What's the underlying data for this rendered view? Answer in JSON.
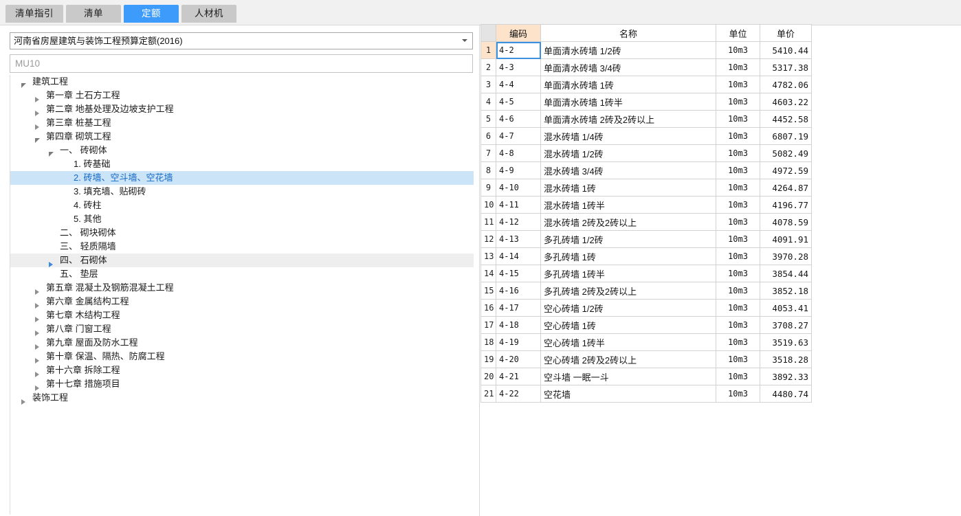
{
  "tabs": [
    {
      "label": "清单指引",
      "active": false
    },
    {
      "label": "清单",
      "active": false
    },
    {
      "label": "定额",
      "active": true
    },
    {
      "label": "人材机",
      "active": false
    }
  ],
  "combo": {
    "value": "河南省房屋建筑与装饰工程预算定额(2016)",
    "arrow_icon": "chevron-down-icon"
  },
  "search": {
    "value": "",
    "placeholder": "MU10"
  },
  "colors": {
    "accent_blue": "#3d9bfb",
    "tab_inactive": "#c9c9c9",
    "selected_row": "#cce4f7",
    "selected_text": "#1569c7",
    "hover_row": "#eeeeee",
    "header_highlight": "#fce3ca",
    "header_index": "#e4e4e4",
    "focus_border": "#3d8fe0",
    "topbar_bg": "#f1f1f1"
  },
  "tree": {
    "nodes": [
      {
        "label": "建筑工程",
        "indent": 0,
        "state": "expanded",
        "selected": false,
        "hovered": false
      },
      {
        "label": "第一章 土石方工程",
        "indent": 1,
        "state": "collapsed",
        "selected": false,
        "hovered": false
      },
      {
        "label": "第二章 地基处理及边坡支护工程",
        "indent": 1,
        "state": "collapsed",
        "selected": false,
        "hovered": false
      },
      {
        "label": "第三章 桩基工程",
        "indent": 1,
        "state": "collapsed",
        "selected": false,
        "hovered": false
      },
      {
        "label": "第四章 砌筑工程",
        "indent": 1,
        "state": "expanded",
        "selected": false,
        "hovered": false
      },
      {
        "label": "一、 砖砌体",
        "indent": 2,
        "state": "expanded",
        "selected": false,
        "hovered": false
      },
      {
        "label": "1. 砖基础",
        "indent": 3,
        "state": "leaf",
        "selected": false,
        "hovered": false
      },
      {
        "label": "2. 砖墙、空斗墙、空花墙",
        "indent": 3,
        "state": "leaf",
        "selected": true,
        "hovered": false
      },
      {
        "label": "3. 填充墙、贴砌砖",
        "indent": 3,
        "state": "leaf",
        "selected": false,
        "hovered": false
      },
      {
        "label": "4. 砖柱",
        "indent": 3,
        "state": "leaf",
        "selected": false,
        "hovered": false
      },
      {
        "label": "5. 其他",
        "indent": 3,
        "state": "leaf",
        "selected": false,
        "hovered": false
      },
      {
        "label": "二、 砌块砌体",
        "indent": 2,
        "state": "leaf",
        "selected": false,
        "hovered": false
      },
      {
        "label": "三、 轻质隔墙",
        "indent": 2,
        "state": "leaf",
        "selected": false,
        "hovered": false
      },
      {
        "label": "四、 石砌体",
        "indent": 2,
        "state": "collapsed",
        "selected": false,
        "hovered": true
      },
      {
        "label": "五、 垫层",
        "indent": 2,
        "state": "leaf",
        "selected": false,
        "hovered": false
      },
      {
        "label": "第五章 混凝土及钢筋混凝土工程",
        "indent": 1,
        "state": "collapsed",
        "selected": false,
        "hovered": false
      },
      {
        "label": "第六章 金属结构工程",
        "indent": 1,
        "state": "collapsed",
        "selected": false,
        "hovered": false
      },
      {
        "label": "第七章 木结构工程",
        "indent": 1,
        "state": "collapsed",
        "selected": false,
        "hovered": false
      },
      {
        "label": "第八章 门窗工程",
        "indent": 1,
        "state": "collapsed",
        "selected": false,
        "hovered": false
      },
      {
        "label": "第九章 屋面及防水工程",
        "indent": 1,
        "state": "collapsed",
        "selected": false,
        "hovered": false
      },
      {
        "label": "第十章 保温、隔热、防腐工程",
        "indent": 1,
        "state": "collapsed",
        "selected": false,
        "hovered": false
      },
      {
        "label": "第十六章 拆除工程",
        "indent": 1,
        "state": "collapsed",
        "selected": false,
        "hovered": false
      },
      {
        "label": "第十七章 措施项目",
        "indent": 1,
        "state": "collapsed",
        "selected": false,
        "hovered": false
      },
      {
        "label": "装饰工程",
        "indent": 0,
        "state": "collapsed",
        "selected": false,
        "hovered": false
      }
    ]
  },
  "table": {
    "headers": {
      "index": "",
      "code": "编码",
      "name": "名称",
      "unit": "单位",
      "price": "单价"
    },
    "rows": [
      {
        "index": "1",
        "code": "4-2",
        "name": "单面清水砖墙 1/2砖",
        "unit": "10m3",
        "price": "5410.44"
      },
      {
        "index": "2",
        "code": "4-3",
        "name": "单面清水砖墙 3/4砖",
        "unit": "10m3",
        "price": "5317.38"
      },
      {
        "index": "3",
        "code": "4-4",
        "name": "单面清水砖墙 1砖",
        "unit": "10m3",
        "price": "4782.06"
      },
      {
        "index": "4",
        "code": "4-5",
        "name": "单面清水砖墙 1砖半",
        "unit": "10m3",
        "price": "4603.22"
      },
      {
        "index": "5",
        "code": "4-6",
        "name": "单面清水砖墙 2砖及2砖以上",
        "unit": "10m3",
        "price": "4452.58"
      },
      {
        "index": "6",
        "code": "4-7",
        "name": "混水砖墙 1/4砖",
        "unit": "10m3",
        "price": "6807.19"
      },
      {
        "index": "7",
        "code": "4-8",
        "name": "混水砖墙 1/2砖",
        "unit": "10m3",
        "price": "5082.49"
      },
      {
        "index": "8",
        "code": "4-9",
        "name": "混水砖墙 3/4砖",
        "unit": "10m3",
        "price": "4972.59"
      },
      {
        "index": "9",
        "code": "4-10",
        "name": "混水砖墙 1砖",
        "unit": "10m3",
        "price": "4264.87"
      },
      {
        "index": "10",
        "code": "4-11",
        "name": "混水砖墙 1砖半",
        "unit": "10m3",
        "price": "4196.77"
      },
      {
        "index": "11",
        "code": "4-12",
        "name": "混水砖墙 2砖及2砖以上",
        "unit": "10m3",
        "price": "4078.59"
      },
      {
        "index": "12",
        "code": "4-13",
        "name": "多孔砖墙 1/2砖",
        "unit": "10m3",
        "price": "4091.91"
      },
      {
        "index": "13",
        "code": "4-14",
        "name": "多孔砖墙 1砖",
        "unit": "10m3",
        "price": "3970.28"
      },
      {
        "index": "14",
        "code": "4-15",
        "name": "多孔砖墙 1砖半",
        "unit": "10m3",
        "price": "3854.44"
      },
      {
        "index": "15",
        "code": "4-16",
        "name": "多孔砖墙 2砖及2砖以上",
        "unit": "10m3",
        "price": "3852.18"
      },
      {
        "index": "16",
        "code": "4-17",
        "name": "空心砖墙 1/2砖",
        "unit": "10m3",
        "price": "4053.41"
      },
      {
        "index": "17",
        "code": "4-18",
        "name": "空心砖墙 1砖",
        "unit": "10m3",
        "price": "3708.27"
      },
      {
        "index": "18",
        "code": "4-19",
        "name": "空心砖墙 1砖半",
        "unit": "10m3",
        "price": "3519.63"
      },
      {
        "index": "19",
        "code": "4-20",
        "name": "空心砖墙 2砖及2砖以上",
        "unit": "10m3",
        "price": "3518.28"
      },
      {
        "index": "20",
        "code": "4-21",
        "name": "空斗墙 一眠一斗",
        "unit": "10m3",
        "price": "3892.33"
      },
      {
        "index": "21",
        "code": "4-22",
        "name": "空花墙",
        "unit": "10m3",
        "price": "4480.74"
      }
    ]
  }
}
